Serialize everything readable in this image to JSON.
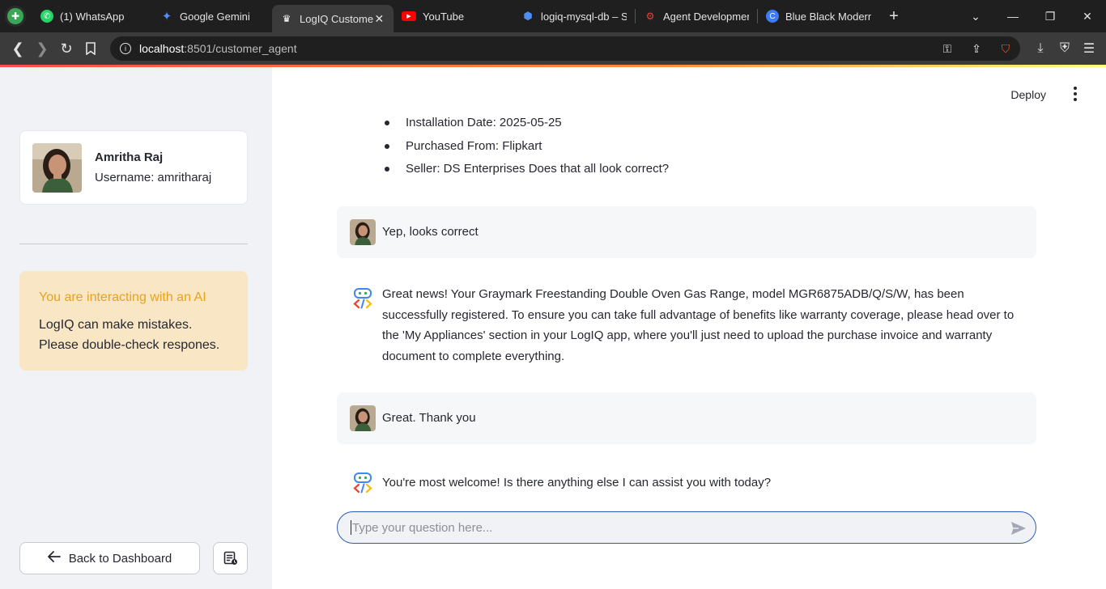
{
  "browser": {
    "tabs": [
      {
        "title": "(1) WhatsApp",
        "color": "#25d366"
      },
      {
        "title": "Google Gemini",
        "color": "#4f8ef7"
      },
      {
        "title": "LogIQ Customer",
        "color": "#3b3b3b",
        "active": true
      },
      {
        "title": "YouTube",
        "color": "#ff0000"
      },
      {
        "title": "logiq-mysql-db – SQ",
        "color": "#4f8ef7"
      },
      {
        "title": "Agent Development",
        "color": "#ea4335"
      },
      {
        "title": "Blue Black Modern F",
        "color": "#3d7bf7"
      }
    ],
    "url_host": "localhost",
    "url_path": ":8501/customer_agent"
  },
  "sidebar": {
    "user_name": "Amritha Raj",
    "username_label": "Username: amritharaj",
    "ai_title": "You are interacting with an AI",
    "ai_body": "LogIQ can make mistakes. Please double-check respones.",
    "back_label": "Back to Dashboard"
  },
  "header": {
    "deploy_label": "Deploy"
  },
  "chat": {
    "bullets": [
      "Installation Date: 2025-05-25",
      "Purchased From: Flipkart",
      "Seller: DS Enterprises Does that all look correct?"
    ],
    "messages": [
      {
        "role": "user",
        "text": "Yep, looks correct"
      },
      {
        "role": "assistant",
        "text": "Great news! Your Graymark Freestanding Double Oven Gas Range, model MGR6875ADB/Q/S/W, has been successfully registered. To ensure you can take full advantage of benefits like warranty coverage, please head over to the 'My Appliances' section in your LogIQ app, where you'll just need to upload the purchase invoice and warranty document to complete everything."
      },
      {
        "role": "user",
        "text": "Great. Thank you"
      },
      {
        "role": "assistant",
        "text": "You're most welcome! Is there anything else I can assist you with today?"
      }
    ],
    "input_placeholder": "Type your question here..."
  }
}
